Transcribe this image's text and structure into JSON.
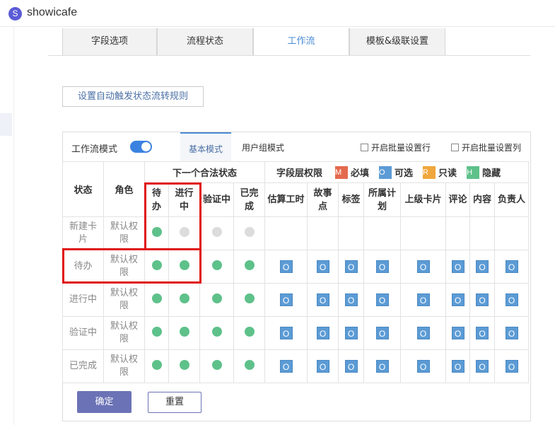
{
  "app": {
    "logo_letter": "S",
    "name": "showicafe"
  },
  "tabs": [
    {
      "label": "字段选项"
    },
    {
      "label": "流程状态"
    },
    {
      "label": "工作流"
    },
    {
      "label": "模板&级联设置"
    }
  ],
  "rule_button": "设置自动触发状态流转规则",
  "mode": {
    "label": "工作流模式",
    "toggle_on": true,
    "tab_basic": "基本模式",
    "tab_group": "用户组模式",
    "batch_row": "开启批量设置行",
    "batch_col": "开启批量设置列"
  },
  "headers": {
    "state": "状态",
    "role": "角色",
    "next_states": "下一个合法状态",
    "field_perm": "字段层权限",
    "next_cols": [
      "待办",
      "进行中",
      "验证中",
      "已完成"
    ],
    "field_cols": [
      "估算工时",
      "故事点",
      "标签",
      "所属计划",
      "上级卡片",
      "评论",
      "内容",
      "负责人"
    ]
  },
  "legend": [
    {
      "letter": "M",
      "text": "必填",
      "color": "#e46a4e"
    },
    {
      "letter": "O",
      "text": "可选",
      "color": "#5b9bd5"
    },
    {
      "letter": "R",
      "text": "只读",
      "color": "#f0a63c"
    },
    {
      "letter": "H",
      "text": "隐藏",
      "color": "#5ec18a"
    }
  ],
  "rows": [
    {
      "state": "新建卡片",
      "role": "默认权限",
      "next": [
        "green",
        "gray",
        "gray",
        "gray"
      ],
      "fields": [
        "",
        "",
        "",
        "",
        "",
        "",
        "",
        ""
      ]
    },
    {
      "state": "待办",
      "role": "默认权限",
      "next": [
        "green",
        "green",
        "green",
        "green"
      ],
      "fields": [
        "O",
        "O",
        "O",
        "O",
        "O",
        "O",
        "O",
        "O"
      ]
    },
    {
      "state": "进行中",
      "role": "默认权限",
      "next": [
        "green",
        "green",
        "green",
        "green"
      ],
      "fields": [
        "O",
        "O",
        "O",
        "O",
        "O",
        "O",
        "O",
        "O"
      ]
    },
    {
      "state": "验证中",
      "role": "默认权限",
      "next": [
        "green",
        "green",
        "green",
        "green"
      ],
      "fields": [
        "O",
        "O",
        "O",
        "O",
        "O",
        "O",
        "O",
        "O"
      ]
    },
    {
      "state": "已完成",
      "role": "默认权限",
      "next": [
        "green",
        "green",
        "green",
        "green"
      ],
      "fields": [
        "O",
        "O",
        "O",
        "O",
        "O",
        "O",
        "O",
        "O"
      ]
    }
  ],
  "buttons": {
    "ok": "确定",
    "reset": "重置"
  },
  "colors": {
    "accent": "#4a8bd6",
    "primary_button": "#6b72b6",
    "highlight": "#e0120f"
  }
}
